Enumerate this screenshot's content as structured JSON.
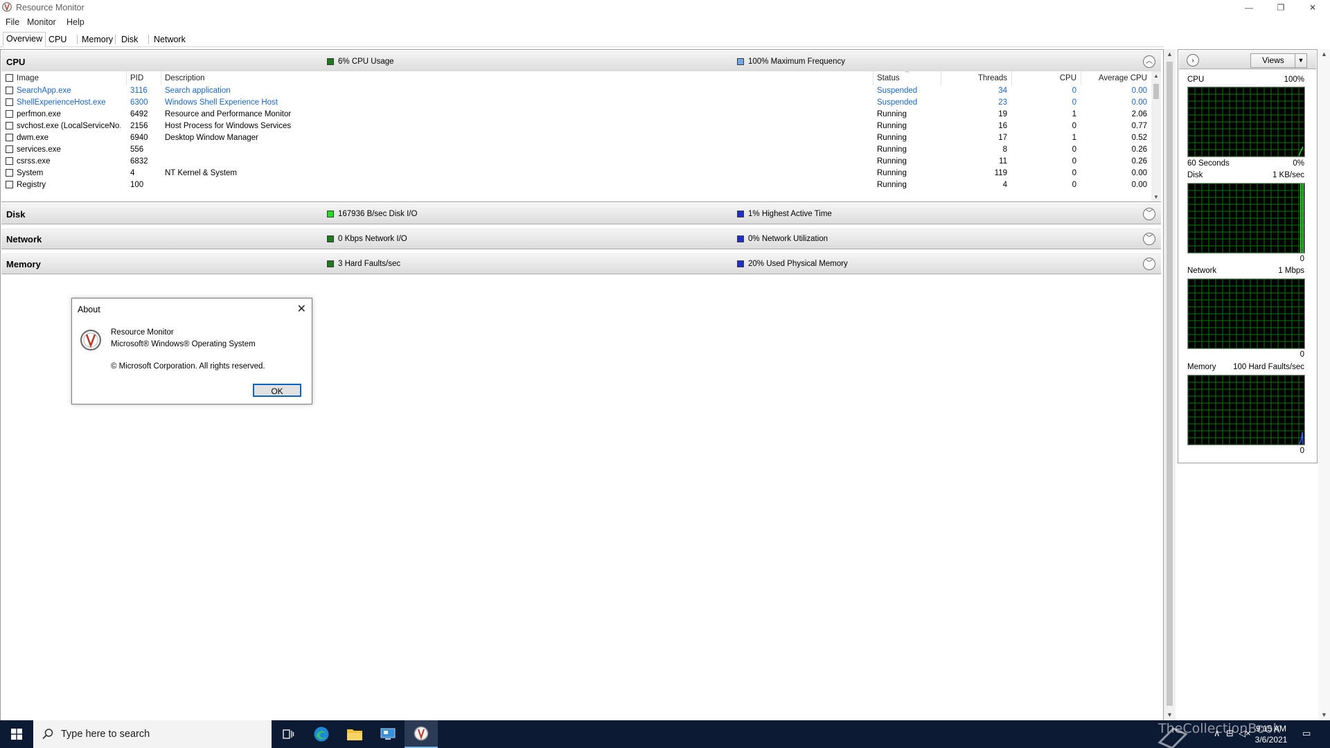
{
  "window": {
    "title": "Resource Monitor",
    "controls": {
      "minimize": "—",
      "restore": "❐",
      "close": "✕"
    }
  },
  "menu": [
    "File",
    "Monitor",
    "Help"
  ],
  "tabs": [
    {
      "label": "Overview",
      "active": true
    },
    {
      "label": "CPU",
      "active": false
    },
    {
      "label": "Memory",
      "active": false
    },
    {
      "label": "Disk",
      "active": false
    },
    {
      "label": "Network",
      "active": false
    }
  ],
  "cpu": {
    "title": "CPU",
    "stat1": "6% CPU Usage",
    "stat2": "100% Maximum Frequency",
    "stat1_color": "#1f7a1f",
    "stat2_color": "#6ea8e8",
    "columns": [
      "Image",
      "PID",
      "Description",
      "Status",
      "Threads",
      "CPU",
      "Average CPU"
    ],
    "rows": [
      {
        "image": "SearchApp.exe",
        "pid": "3116",
        "description": "Search application",
        "status": "Suspended",
        "threads": "34",
        "cpu": "0",
        "avg": "0.00",
        "suspended": true
      },
      {
        "image": "ShellExperienceHost.exe",
        "pid": "6300",
        "description": "Windows Shell Experience Host",
        "status": "Suspended",
        "threads": "23",
        "cpu": "0",
        "avg": "0.00",
        "suspended": true
      },
      {
        "image": "perfmon.exe",
        "pid": "6492",
        "description": "Resource and Performance Monitor",
        "status": "Running",
        "threads": "19",
        "cpu": "1",
        "avg": "2.06"
      },
      {
        "image": "svchost.exe (LocalServiceNo...",
        "pid": "2156",
        "description": "Host Process for Windows Services",
        "status": "Running",
        "threads": "16",
        "cpu": "0",
        "avg": "0.77"
      },
      {
        "image": "dwm.exe",
        "pid": "6940",
        "description": "Desktop Window Manager",
        "status": "Running",
        "threads": "17",
        "cpu": "1",
        "avg": "0.52"
      },
      {
        "image": "services.exe",
        "pid": "556",
        "description": "",
        "status": "Running",
        "threads": "8",
        "cpu": "0",
        "avg": "0.26"
      },
      {
        "image": "csrss.exe",
        "pid": "6832",
        "description": "",
        "status": "Running",
        "threads": "11",
        "cpu": "0",
        "avg": "0.26"
      },
      {
        "image": "System",
        "pid": "4",
        "description": "NT Kernel & System",
        "status": "Running",
        "threads": "119",
        "cpu": "0",
        "avg": "0.00"
      },
      {
        "image": "Registry",
        "pid": "100",
        "description": "",
        "status": "Running",
        "threads": "4",
        "cpu": "0",
        "avg": "0.00"
      }
    ]
  },
  "disk": {
    "title": "Disk",
    "stat1": "167936 B/sec Disk I/O",
    "stat2": "1% Highest Active Time",
    "stat1_color": "#22dd22",
    "stat2_color": "#1d2fd0"
  },
  "network": {
    "title": "Network",
    "stat1": "0 Kbps Network I/O",
    "stat2": "0% Network Utilization",
    "stat1_color": "#1f7a1f",
    "stat2_color": "#1d2fd0"
  },
  "memory": {
    "title": "Memory",
    "stat1": "3 Hard Faults/sec",
    "stat2": "20% Used Physical Memory",
    "stat1_color": "#1f7a1f",
    "stat2_color": "#1d2fd0"
  },
  "side": {
    "views_label": "Views",
    "graphs": [
      {
        "name": "CPU",
        "scale": "100%",
        "footer_left": "60 Seconds",
        "footer_right": "0%"
      },
      {
        "name": "Disk",
        "scale": "1 KB/sec",
        "footer_left": "",
        "footer_right": "0"
      },
      {
        "name": "Network",
        "scale": "1 Mbps",
        "footer_left": "",
        "footer_right": "0"
      },
      {
        "name": "Memory",
        "scale": "100 Hard Faults/sec",
        "footer_left": "",
        "footer_right": "0"
      }
    ]
  },
  "about": {
    "title": "About",
    "line1": "Resource Monitor",
    "line2": "Microsoft® Windows® Operating System",
    "line3": "© Microsoft Corporation. All rights reserved.",
    "ok": "OK"
  },
  "taskbar": {
    "search_placeholder": "Type here to search",
    "time": "9:15 AM",
    "date": "3/6/2021",
    "watermark": "TheCollectionBook"
  }
}
